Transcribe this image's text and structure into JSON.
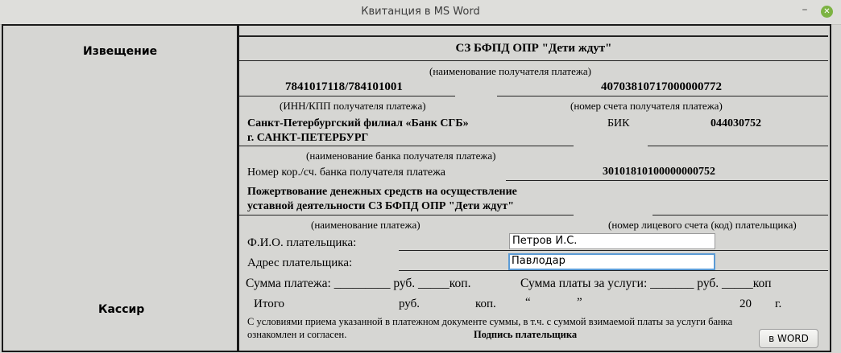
{
  "window": {
    "title": "Квитанция в MS Word"
  },
  "left": {
    "notice": "Извещение",
    "cashier": "Кассир"
  },
  "receipt": {
    "recipient_name": "СЗ БФПД ОПР \"Дети ждут\"",
    "recipient_name_caption": "(наименование получателя платежа)",
    "inn_kpp": "7841017118/784101001",
    "account": "40703810717000000772",
    "inn_kpp_caption": "(ИНН/КПП получателя платежа)",
    "account_caption": "(номер счета получателя платежа)",
    "bank_name_line1": "Санкт-Петербургский филиал «Банк СГБ»",
    "bank_name_line2": "г. САНКТ-ПЕТЕРБУРГ",
    "bik_label": "БИК",
    "bik": "044030752",
    "bank_caption": "(наименование банка получателя платежа)",
    "corr_account_label": "Номер кор./сч. банка получателя платежа",
    "corr_account": "30101810100000000752",
    "payment_name_line1": "Пожертвование денежных средств на осуществление",
    "payment_name_line2": "уставной деятельности СЗ БФПД ОПР \"Дети ждут\"",
    "payment_name_caption": "(наименование платежа)",
    "payer_account_caption": "(номер лицевого счета (код) плательщика)",
    "payer_name_label": "Ф.И.О. плательщика:",
    "payer_name_value": "Петров И.С.",
    "payer_address_label": "Адрес плательщика:",
    "payer_address_value": "Павлодар",
    "sum_line": "Сумма платежа: _________ руб. _____коп.",
    "service_sum_line": "Сумма платы за услуги: _______ руб. _____коп",
    "total_label": "Итого",
    "total_rub": "руб.",
    "total_kop": "коп.",
    "quote_open": "“",
    "quote_close": "”",
    "year_20": "20",
    "year_g": "г.",
    "terms_line1": "С условиями приема указанной в платежном документе суммы, в т.ч. с суммой взимаемой платы за услуги банка",
    "terms_line2": "ознакомлен и согласен.",
    "signature_label": "Подпись плательщика"
  },
  "actions": {
    "word_button": "в WORD"
  }
}
